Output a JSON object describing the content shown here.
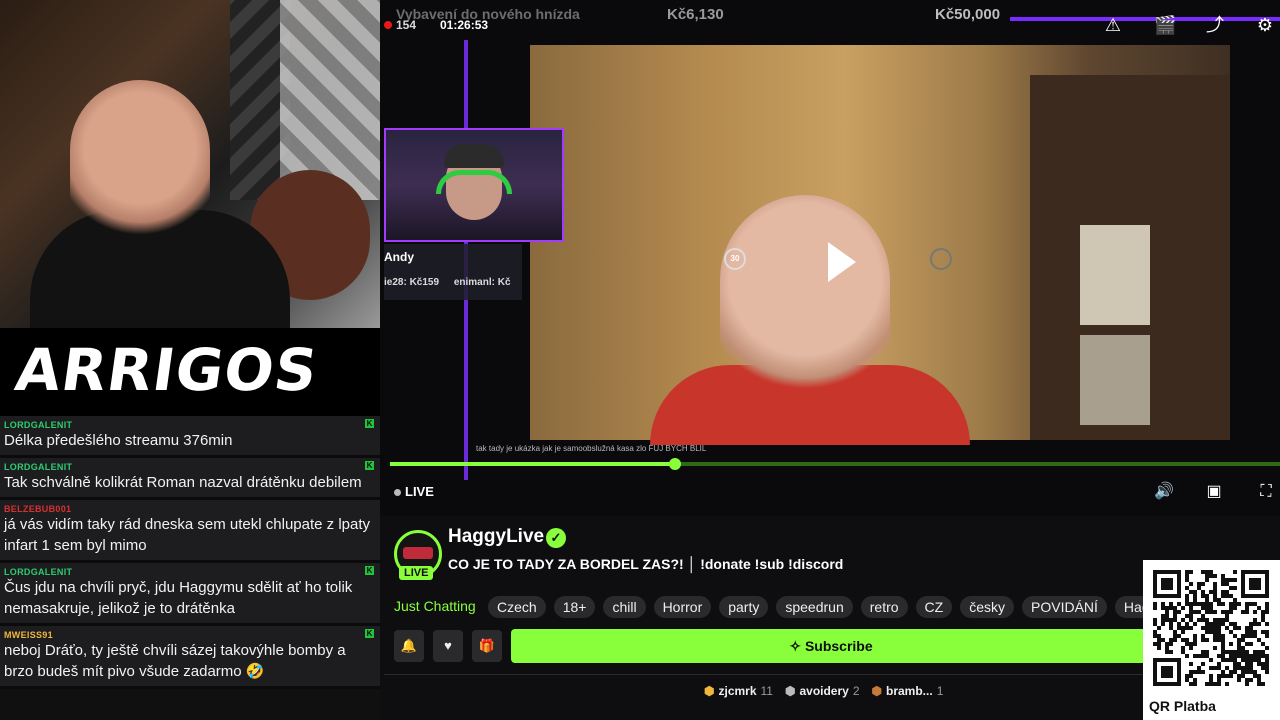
{
  "overlay": {
    "logo": "ARRIGOS",
    "viewers": "154",
    "uptime": "01:26:53",
    "goal_title": "Vybavení do nového hnízda",
    "goal_current": "Kč6,130",
    "goal_target": "Kč50,000",
    "cam_name": "Andy",
    "recent_subs": [
      "ie28: Kč159",
      "enimanl: Kč"
    ],
    "subtitle_text": "tak tady je ukázka jak je samoobslužná kasa zlo FUJ BYCH BLIL"
  },
  "chat": {
    "messages": [
      {
        "user": "LORDGALENIT",
        "user_color": "#2ecc71",
        "text": "Délka předešlého streamu 376min"
      },
      {
        "user": "LORDGALENIT",
        "user_color": "#2ecc71",
        "text": "Tak schválně kolikrát Roman nazval drátěnku debilem"
      },
      {
        "user": "BELZEBUB001",
        "user_color": "#d63031",
        "text": "já vás vidím taky rád dneska sem utekl chlupate z lpaty infart 1 sem byl mimo"
      },
      {
        "user": "LORDGALENIT",
        "user_color": "#2ecc71",
        "text": "Čus jdu na chvíli pryč, jdu Haggymu sdělit ať ho tolik nemasakruje, jelikož je to drátěnka"
      },
      {
        "user": "MWEISS91",
        "user_color": "#f0b73a",
        "text": "neboj Dráťo, ty ještě chvíli sázej takovýhle bomby a brzo budeš mít pivo všude zadarmo 🤣"
      }
    ]
  },
  "player": {
    "live_label": "LIVE",
    "rewind_label": "30",
    "progress_fraction": 0.32
  },
  "channel": {
    "name": "HaggyLive",
    "live_badge": "LIVE",
    "title": "CO JE TO TADY ZA BORDEL ZAS?! │ !donate !sub !discord",
    "category": "Just Chatting",
    "tags": [
      "Czech",
      "18+",
      "chill",
      "Horror",
      "party",
      "speedrun",
      "retro",
      "CZ",
      "česky",
      "POVIDÁNÍ",
      "Hagg"
    ],
    "subscribe_label": "Subscribe",
    "leaderboard": [
      {
        "name": "zjcmrk",
        "count": "11"
      },
      {
        "name": "avoidery",
        "count": "2"
      },
      {
        "name": "bramb...",
        "count": "1"
      }
    ]
  },
  "qr": {
    "label": "QR Platba"
  },
  "colors": {
    "accent": "#89ff3c",
    "purple": "#7a2bff",
    "background": "#0e0e10"
  }
}
